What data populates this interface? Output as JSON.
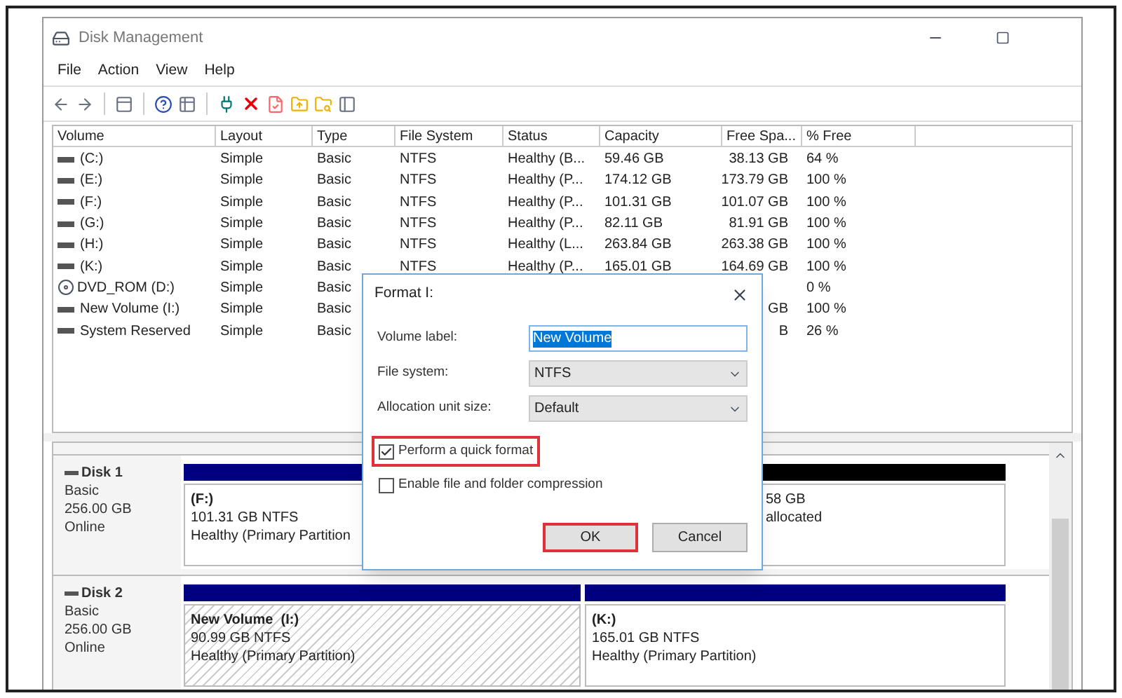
{
  "window": {
    "title": "Disk Management"
  },
  "menu": [
    "File",
    "Action",
    "View",
    "Help"
  ],
  "table": {
    "columns": [
      "Volume",
      "Layout",
      "Type",
      "File System",
      "Status",
      "Capacity",
      "Free Spa...",
      "% Free"
    ],
    "rows": [
      {
        "kind": "drive",
        "cells": [
          "(C:)",
          "Simple",
          "Basic",
          "NTFS",
          "Healthy (B...",
          "59.46 GB",
          "38.13 GB",
          "64 %"
        ]
      },
      {
        "kind": "drive",
        "cells": [
          "(E:)",
          "Simple",
          "Basic",
          "NTFS",
          "Healthy (P...",
          "174.12 GB",
          "173.79 GB",
          "100 %"
        ]
      },
      {
        "kind": "drive",
        "cells": [
          "(F:)",
          "Simple",
          "Basic",
          "NTFS",
          "Healthy (P...",
          "101.31 GB",
          "101.07 GB",
          "100 %"
        ]
      },
      {
        "kind": "drive",
        "cells": [
          "(G:)",
          "Simple",
          "Basic",
          "NTFS",
          "Healthy (P...",
          "82.11 GB",
          "81.91 GB",
          "100 %"
        ]
      },
      {
        "kind": "drive",
        "cells": [
          "(H:)",
          "Simple",
          "Basic",
          "NTFS",
          "Healthy (L...",
          "263.84 GB",
          "263.38 GB",
          "100 %"
        ]
      },
      {
        "kind": "drive",
        "cells": [
          "(K:)",
          "Simple",
          "Basic",
          "NTFS",
          "Healthy (P...",
          "165.01 GB",
          "164.69 GB",
          "100 %"
        ]
      },
      {
        "kind": "dvd",
        "cells": [
          "DVD_ROM (D:)",
          "Simple",
          "Basic",
          null,
          null,
          null,
          null,
          "0 %"
        ]
      },
      {
        "kind": "drive",
        "cells": [
          "New Volume (I:)",
          "Simple",
          "Basic",
          null,
          null,
          null,
          "GB",
          "100 %"
        ]
      },
      {
        "kind": "drive",
        "cells": [
          "System Reserved",
          "Simple",
          "Basic",
          null,
          null,
          null,
          "B",
          "26 %"
        ]
      }
    ]
  },
  "disks": [
    {
      "name": "Disk 1",
      "type": "Basic",
      "size": "256.00 GB",
      "status": "Online",
      "partitions": [
        {
          "kind": "primary",
          "selected": false,
          "label": "(F:)",
          "size": "101.31 GB NTFS",
          "status": "Healthy (Primary Partition"
        },
        {
          "kind": "unallocated",
          "selected": false,
          "size": "58 GB",
          "status": "allocated"
        }
      ]
    },
    {
      "name": "Disk 2",
      "type": "Basic",
      "size": "256.00 GB",
      "status": "Online",
      "partitions": [
        {
          "kind": "primary",
          "selected": true,
          "label": "New Volume  (I:)",
          "size": "90.99 GB NTFS",
          "status": "Healthy (Primary Partition)"
        },
        {
          "kind": "primary",
          "selected": false,
          "label": "(K:)",
          "size": "165.01 GB NTFS",
          "status": "Healthy (Primary Partition)"
        }
      ]
    }
  ],
  "dialog": {
    "title": "Format I:",
    "fields": [
      {
        "kind": "text",
        "label": "Volume label:",
        "value": "New Volume"
      },
      {
        "kind": "select",
        "label": "File system:",
        "value": "NTFS"
      },
      {
        "kind": "select",
        "label": "Allocation unit size:",
        "value": "Default"
      }
    ],
    "options": [
      {
        "label": "Perform a quick format",
        "checked": true,
        "highlighted": true
      },
      {
        "label": "Enable file and folder compression",
        "checked": false,
        "highlighted": false
      }
    ],
    "buttons": [
      {
        "label": "OK",
        "highlighted": true
      },
      {
        "label": "Cancel",
        "highlighted": false
      }
    ]
  }
}
